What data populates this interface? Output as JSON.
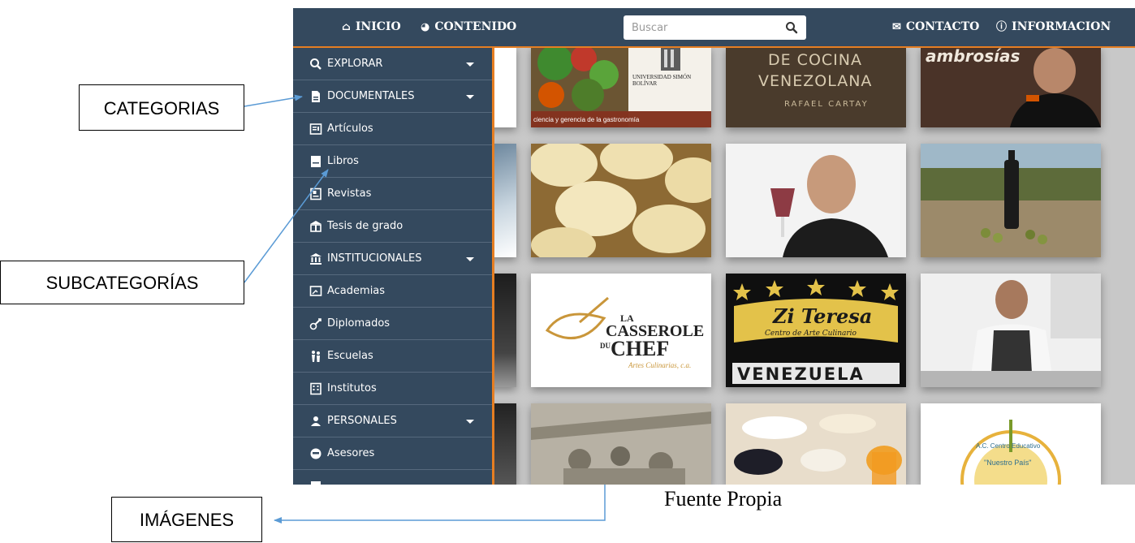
{
  "topnav": {
    "inicio": "INICIO",
    "contenido": "CONTENIDO",
    "contacto": "CONTACTO",
    "informacion": "INFORMACION",
    "search_placeholder": "Buscar"
  },
  "sidebar": {
    "explorar": "EXPLORAR",
    "documentales": "DOCUMENTALES",
    "articulos": "Artículos",
    "libros": "Libros",
    "revistas": "Revistas",
    "tesis": "Tesis de grado",
    "institucionales": "INSTITUCIONALES",
    "academias": "Academias",
    "diplomados": "Diplomados",
    "escuelas": "Escuelas",
    "institutos": "Institutos",
    "personales": "PERSONALES",
    "asesores": "Asesores"
  },
  "tiles": {
    "usb_text": "UNIVERSIDAD SIMÓN BOLÍVAR",
    "gastro_text": "ciencia y gerencia de la gastronomía",
    "cocina_line1": "DE COCINA",
    "cocina_line2": "VENEZOLANA",
    "cocina_author": "RAFAEL CARTAY",
    "ambrosia": "ambrosías",
    "la": "LA",
    "casserole": "CASSEROLE",
    "du": "DU",
    "chef": "CHEF",
    "casserole_sub": "Artes Culinarias, c.a.",
    "zi_teresa": "Zi Teresa",
    "zi_sub": "Centro de Arte Culinario",
    "venezuela": "VENEZUELA",
    "nuestro_pais": "\"Nuestro País\"",
    "ac_centro": "A.C. Centro Educativo"
  },
  "annotations": {
    "categorias": "CATEGORIAS",
    "subcategorias": "SUBCATEGORÍAS",
    "imagenes": "IMÁGENES",
    "caption": "Fuente Propia"
  },
  "colors": {
    "nav_bg": "#34495e",
    "accent": "#e67e22",
    "arrow": "#5b9bd5"
  }
}
